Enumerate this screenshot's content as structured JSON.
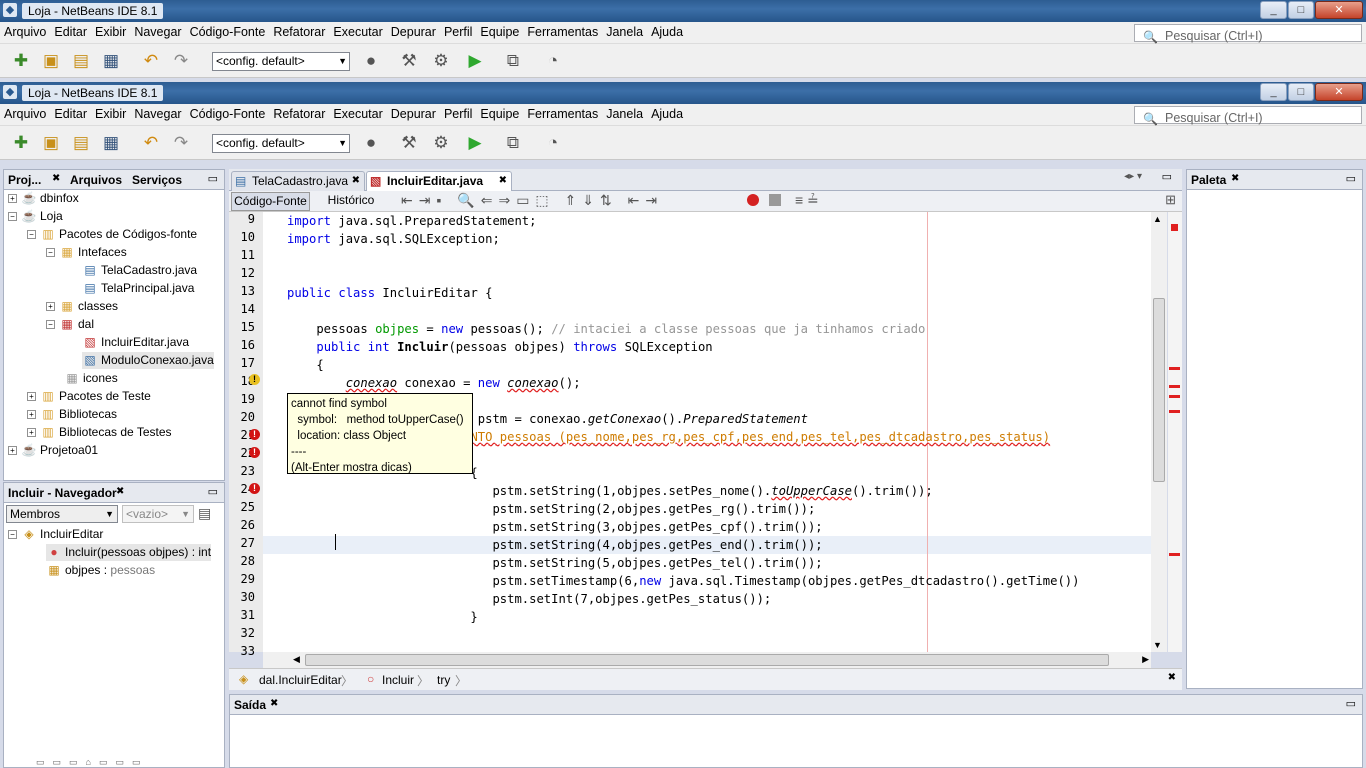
{
  "windows": [
    {
      "title": "Loja - NetBeans IDE 8.1"
    },
    {
      "title": "Loja - NetBeans IDE 8.1"
    }
  ],
  "menu": [
    "Arquivo",
    "Editar",
    "Exibir",
    "Navegar",
    "Código-Fonte",
    "Refatorar",
    "Executar",
    "Depurar",
    "Perfil",
    "Equipe",
    "Ferramentas",
    "Janela",
    "Ajuda"
  ],
  "search": {
    "placeholder": "Pesquisar (Ctrl+I)"
  },
  "config_combo": "<config. default>",
  "projects_panel": {
    "tabs": [
      "Proj...",
      "Arquivos",
      "Serviços"
    ],
    "tree": [
      "dbinfox",
      "Loja",
      "Pacotes de Códigos-fonte",
      "Intefaces",
      "TelaCadastro.java",
      "TelaPrincipal.java",
      "classes",
      "dal",
      "IncluirEditar.java",
      "ModuloConexao.java",
      "icones",
      "Pacotes de Teste",
      "Bibliotecas",
      "Bibliotecas de Testes",
      "Projetoa01"
    ]
  },
  "navigator": {
    "title": "Incluir - Navegador",
    "filter": "Membros",
    "empty": "<vazio>",
    "items": [
      "IncluirEditar",
      "Incluir(pessoas objpes) : int",
      "objpes",
      "pessoas"
    ]
  },
  "editor": {
    "tabs": [
      "TelaCadastro.java",
      "IncluirEditar.java"
    ],
    "source_btn": "Código-Fonte",
    "history_btn": "Histórico",
    "line_numbers": [
      "9",
      "10",
      "11",
      "12",
      "13",
      "14",
      "15",
      "16",
      "17",
      "18",
      "19",
      "20",
      "21",
      "22",
      "23",
      "24",
      "25",
      "26",
      "27",
      "28",
      "29",
      "30",
      "31",
      "32",
      "33"
    ],
    "tooltip": [
      "cannot find symbol",
      "  symbol:   method toUpperCase()",
      "  location: class Object",
      "----",
      "(Alt-Enter mostra dicas)"
    ],
    "breadcrumb": [
      "dal.IncluirEditar",
      "Incluir",
      "try"
    ]
  },
  "palette": {
    "title": "Paleta"
  },
  "output": {
    "title": "Saída"
  },
  "colors": {
    "keyword": "#0000e6",
    "comment": "#969696",
    "error": "#d21414",
    "string": "#ce7b00"
  }
}
